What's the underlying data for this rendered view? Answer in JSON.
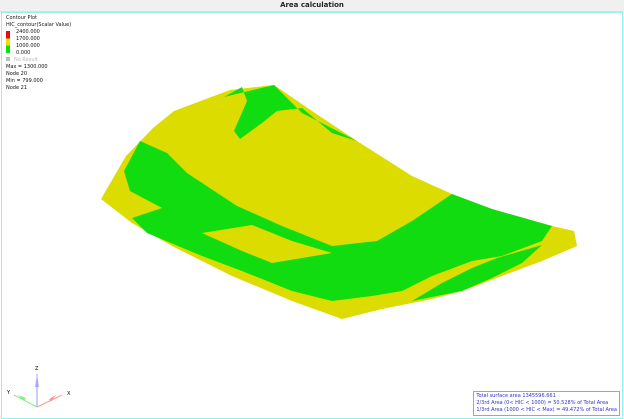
{
  "window_title": "Area calculation",
  "legend": {
    "title": "Contour Plot",
    "subtitle": "HIC_contour(Scalar Value)",
    "levels": [
      "2400.000",
      "1700.000",
      "1000.000",
      "0.000"
    ],
    "colors": [
      "#e01010",
      "#e8e000",
      "#10e010"
    ],
    "no_result": "No Result",
    "max": "Max = 1300.000",
    "max_node": "Node 20",
    "min": "Min = 799.000",
    "min_node": "Node 21"
  },
  "info": {
    "line1": "Total surface area 1345596.661",
    "line2": "2/3rd Area (0< HIC < 1000) = 50.528% of Total Area",
    "line3": "1/3rd Area (1000 < HIC < Max) = 49.472% of Total Area"
  },
  "axes": {
    "x": "X",
    "y": "Y",
    "z": "Z"
  }
}
